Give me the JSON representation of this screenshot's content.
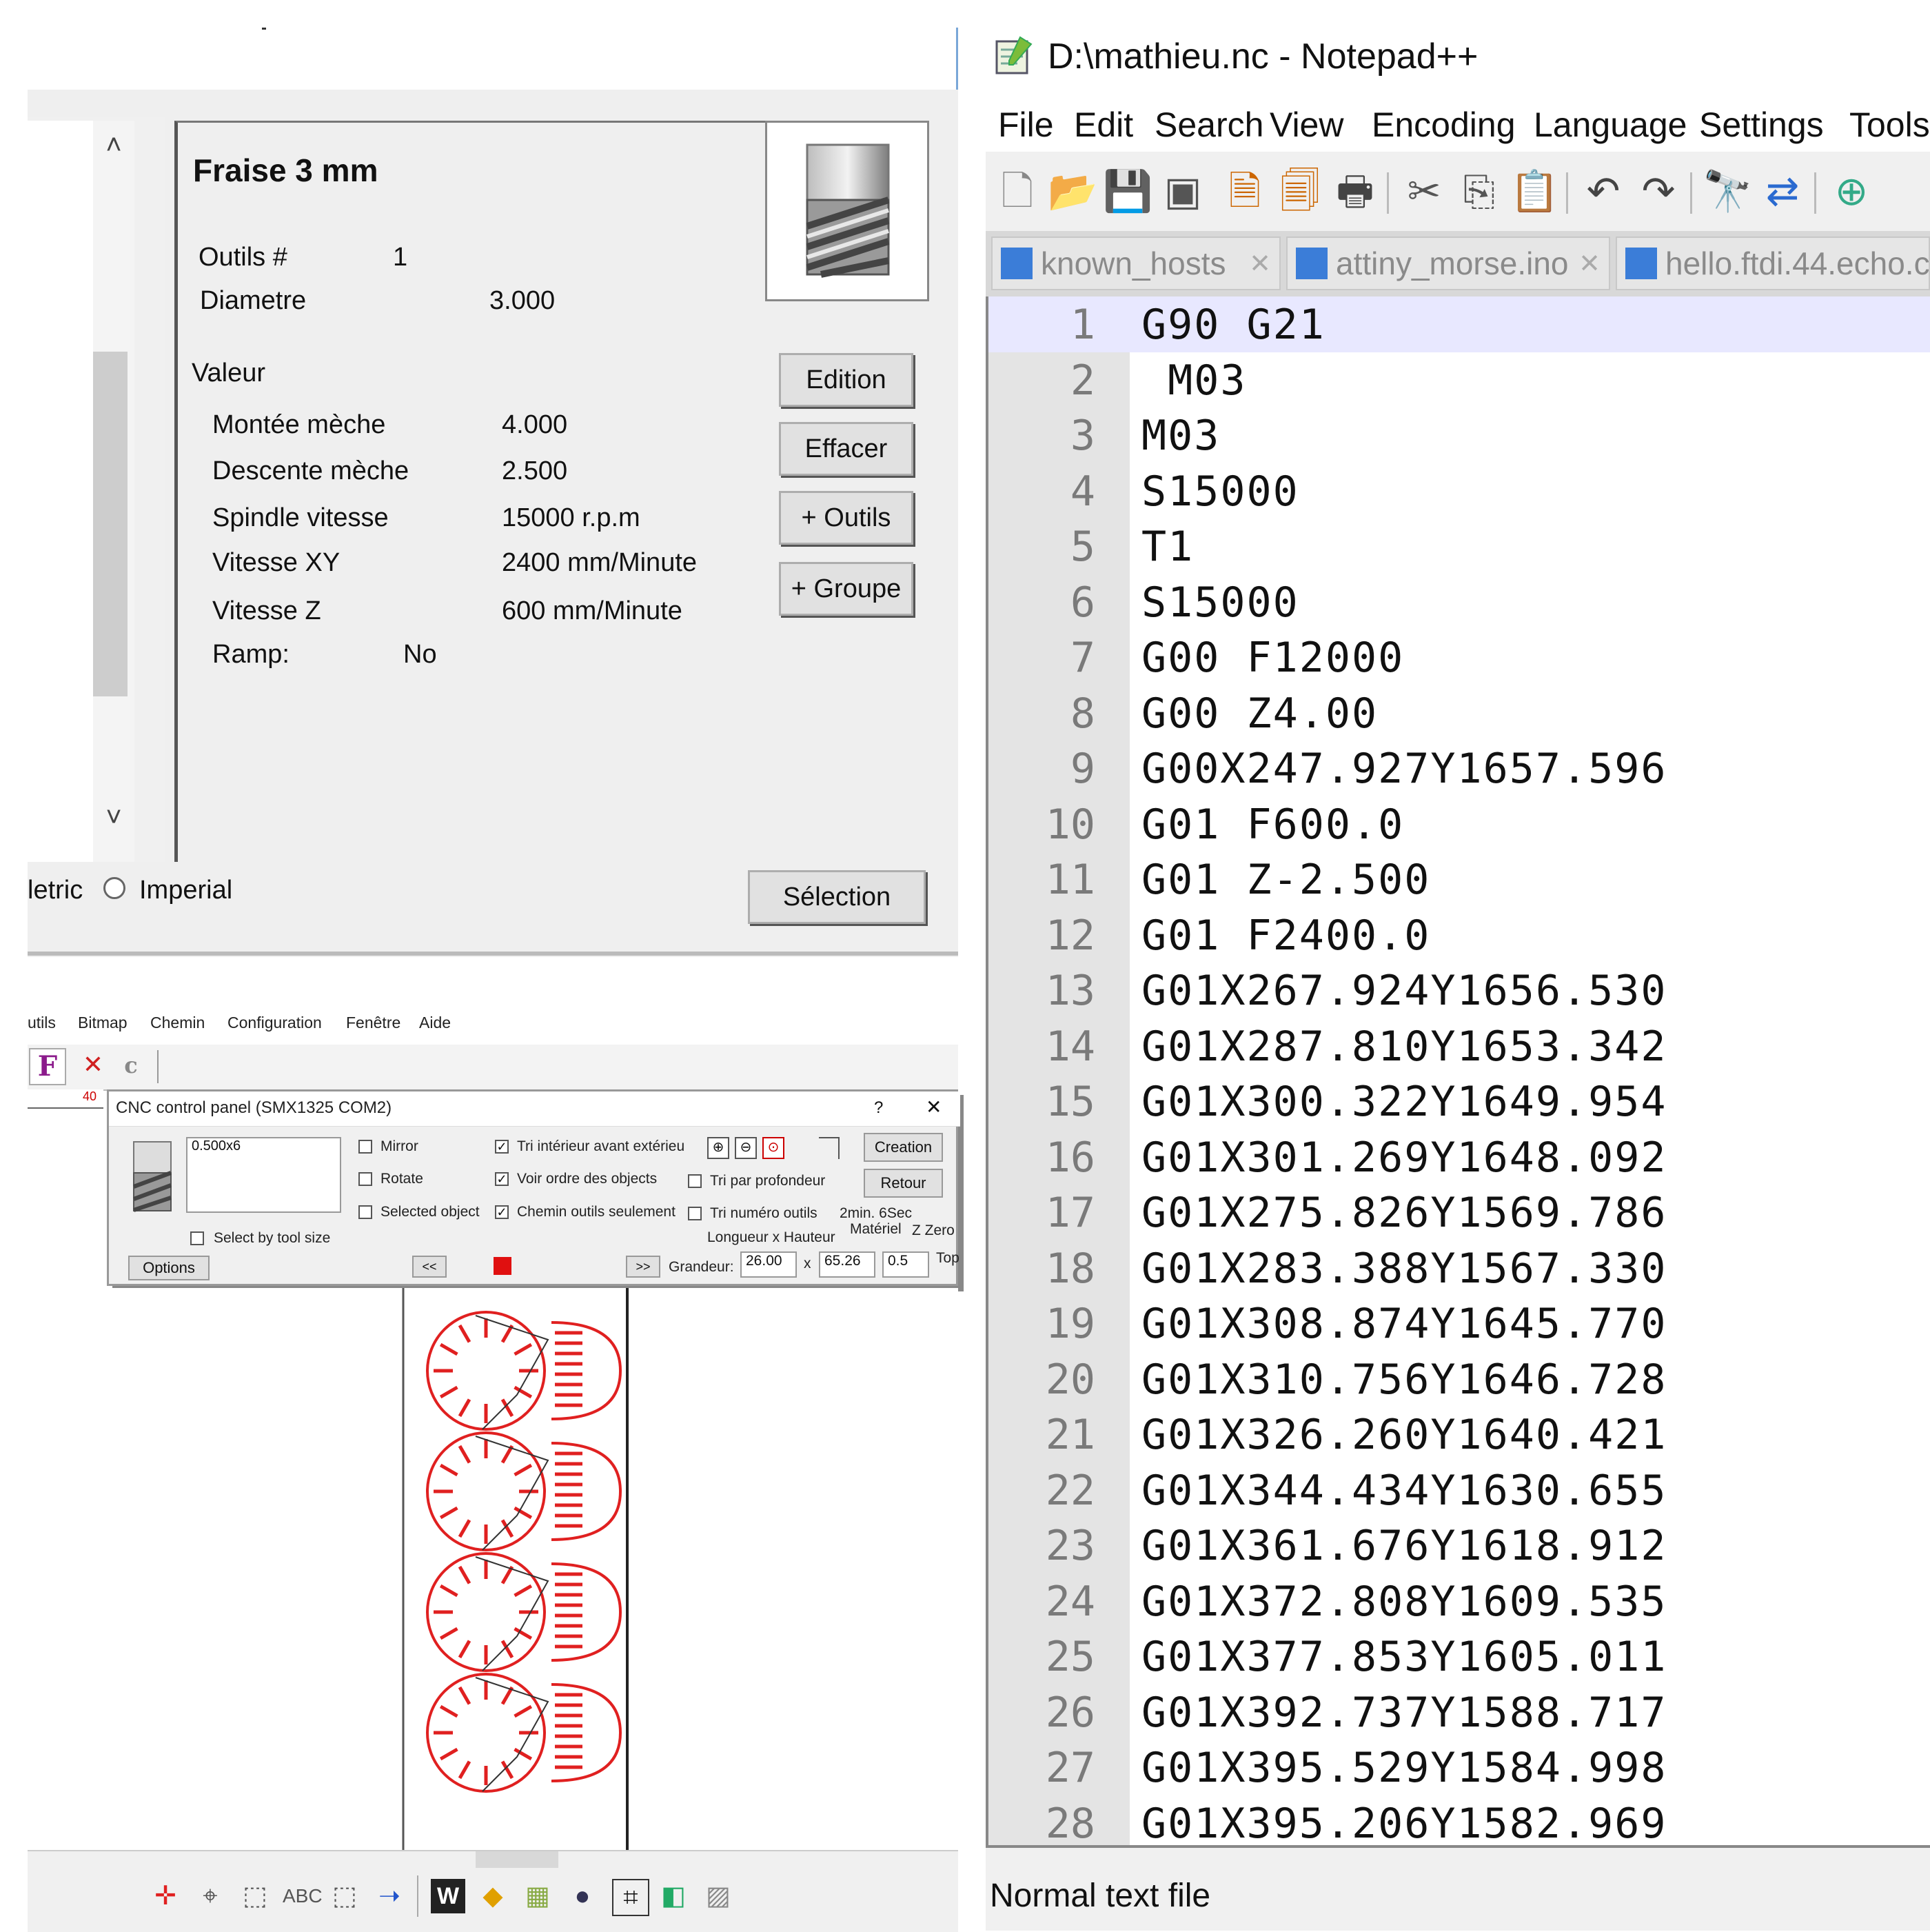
{
  "tool_panel": {
    "title": "Fraise 3 mm",
    "outils_label": "Outils #",
    "outils_value": "1",
    "diametre_label": "Diametre",
    "diametre_value": "3.000",
    "valeur_label": "Valeur",
    "rows": [
      {
        "label": "Montée mèche",
        "value": "4.000"
      },
      {
        "label": "Descente mèche",
        "value": "2.500"
      },
      {
        "label": "Spindle vitesse",
        "value": "15000 r.p.m"
      },
      {
        "label": "Vitesse XY",
        "value": "2400 mm/Minute"
      },
      {
        "label": "Vitesse Z",
        "value": "600 mm/Minute"
      },
      {
        "label": "Ramp:",
        "value": "No"
      }
    ],
    "buttons": {
      "edition": "Edition",
      "effacer": "Effacer",
      "outils": "+ Outils",
      "groupe": "+ Groupe",
      "selection": "Sélection"
    },
    "units": {
      "metric": "letric",
      "imperial": "Imperial"
    }
  },
  "cnc_app": {
    "menu": [
      "utils",
      "Bitmap",
      "Chemin",
      "Configuration",
      "Fenêtre",
      "Aide"
    ],
    "toolbar": {
      "f": "F",
      "x": "✕",
      "c": "c"
    },
    "ruler_number": "40",
    "dialog": {
      "title": "CNC control panel  (SMX1325  COM2)",
      "help": "?",
      "close": "✕",
      "tool_list_value": "0.500x6",
      "checkboxes": [
        {
          "label": "Mirror",
          "checked": false
        },
        {
          "label": "Rotate",
          "checked": false
        },
        {
          "label": "Selected object",
          "checked": false
        },
        {
          "label": "Tri intérieur avant extérieu",
          "checked": true
        },
        {
          "label": "Voir ordre des objects",
          "checked": true
        },
        {
          "label": "Chemin outils seulement",
          "checked": true
        },
        {
          "label": "Tri par profondeur",
          "checked": false
        },
        {
          "label": "Tri numéro outils",
          "checked": false
        },
        {
          "label": "Select by tool size",
          "checked": false
        }
      ],
      "creation": "Creation",
      "retour": "Retour",
      "time": "2min. 6Sec",
      "longueur_hauteur": "Longueur x Hauteur",
      "materiel": "Matériel",
      "zzero": "Z Zero",
      "grandeur_label": "Grandeur:",
      "longueur": "26.00",
      "x": "x",
      "hauteur": "65.26",
      "materiel_value": "0.5",
      "top": "Top",
      "options": "Options",
      "prev": "<<",
      "next": ">>"
    }
  },
  "notepad": {
    "title": "D:\\mathieu.nc - Notepad++",
    "menu": [
      "File",
      "Edit",
      "Search",
      "View",
      "Encoding",
      "Language",
      "Settings",
      "Tools"
    ],
    "tabs": [
      {
        "label": "known_hosts",
        "close": "✕"
      },
      {
        "label": "attiny_morse.ino",
        "close": "✕"
      },
      {
        "label": "hello.ftdi.44.echo.c",
        "close": ""
      }
    ],
    "lines": [
      {
        "n": "1",
        "code": "G90 G21"
      },
      {
        "n": "2",
        "code": " M03"
      },
      {
        "n": "3",
        "code": "M03"
      },
      {
        "n": "4",
        "code": "S15000"
      },
      {
        "n": "5",
        "code": "T1"
      },
      {
        "n": "6",
        "code": "S15000"
      },
      {
        "n": "7",
        "code": "G00 F12000"
      },
      {
        "n": "8",
        "code": "G00 Z4.00"
      },
      {
        "n": "9",
        "code": "G00X247.927Y1657.596"
      },
      {
        "n": "10",
        "code": "G01 F600.0"
      },
      {
        "n": "11",
        "code": "G01 Z-2.500"
      },
      {
        "n": "12",
        "code": "G01 F2400.0"
      },
      {
        "n": "13",
        "code": "G01X267.924Y1656.530"
      },
      {
        "n": "14",
        "code": "G01X287.810Y1653.342"
      },
      {
        "n": "15",
        "code": "G01X300.322Y1649.954"
      },
      {
        "n": "16",
        "code": "G01X301.269Y1648.092"
      },
      {
        "n": "17",
        "code": "G01X275.826Y1569.786"
      },
      {
        "n": "18",
        "code": "G01X283.388Y1567.330"
      },
      {
        "n": "19",
        "code": "G01X308.874Y1645.770"
      },
      {
        "n": "20",
        "code": "G01X310.756Y1646.728"
      },
      {
        "n": "21",
        "code": "G01X326.260Y1640.421"
      },
      {
        "n": "22",
        "code": "G01X344.434Y1630.655"
      },
      {
        "n": "23",
        "code": "G01X361.676Y1618.912"
      },
      {
        "n": "24",
        "code": "G01X372.808Y1609.535"
      },
      {
        "n": "25",
        "code": "G01X377.853Y1605.011"
      },
      {
        "n": "26",
        "code": "G01X392.737Y1588.717"
      },
      {
        "n": "27",
        "code": "G01X395.529Y1584.998"
      },
      {
        "n": "28",
        "code": "G01X395.206Y1582.969"
      }
    ],
    "status": "Normal text file"
  },
  "colors": {
    "accent": "#3b7dd8",
    "path_red": "#e02020",
    "active_line": "#e8e8ff"
  }
}
